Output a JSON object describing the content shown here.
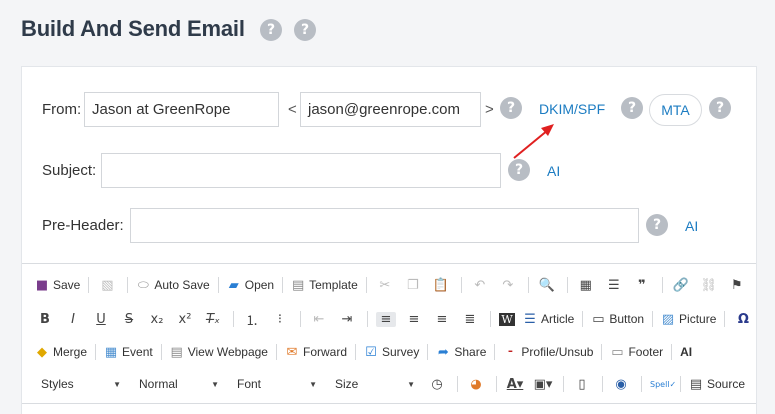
{
  "page": {
    "title": "Build And Send Email",
    "help_icon": "?"
  },
  "from": {
    "label": "From:",
    "name_value": "Jason at GreenRope",
    "left_bracket": "<",
    "email_value": "jason@greenrope.com",
    "right_bracket": ">",
    "dkim_link": "DKIM/SPF",
    "mta_button": "MTA"
  },
  "subject": {
    "label": "Subject:",
    "value": "",
    "ai_link": "AI"
  },
  "preheader": {
    "label": "Pre-Header:",
    "value": "",
    "ai_link": "AI"
  },
  "annotation": {
    "arrow_color": "#e02020"
  },
  "toolbar": {
    "row1": {
      "save": "Save",
      "auto_save": "Auto Save",
      "open": "Open",
      "template": "Template"
    },
    "row2": {
      "article": "Article",
      "button": "Button",
      "picture": "Picture"
    },
    "row3": {
      "merge": "Merge",
      "event": "Event",
      "view_webpage": "View Webpage",
      "forward": "Forward",
      "survey": "Survey",
      "share": "Share",
      "profile": "Profile/Unsub",
      "footer": "Footer",
      "ai": "AI"
    },
    "row4": {
      "styles": "Styles",
      "format": "Normal",
      "font": "Font",
      "size": "Size",
      "source": "Source",
      "spell_label": "Spell"
    }
  },
  "colors": {
    "link": "#1c7cc2",
    "help": "#b8bdc4",
    "title": "#2f3b4a"
  }
}
